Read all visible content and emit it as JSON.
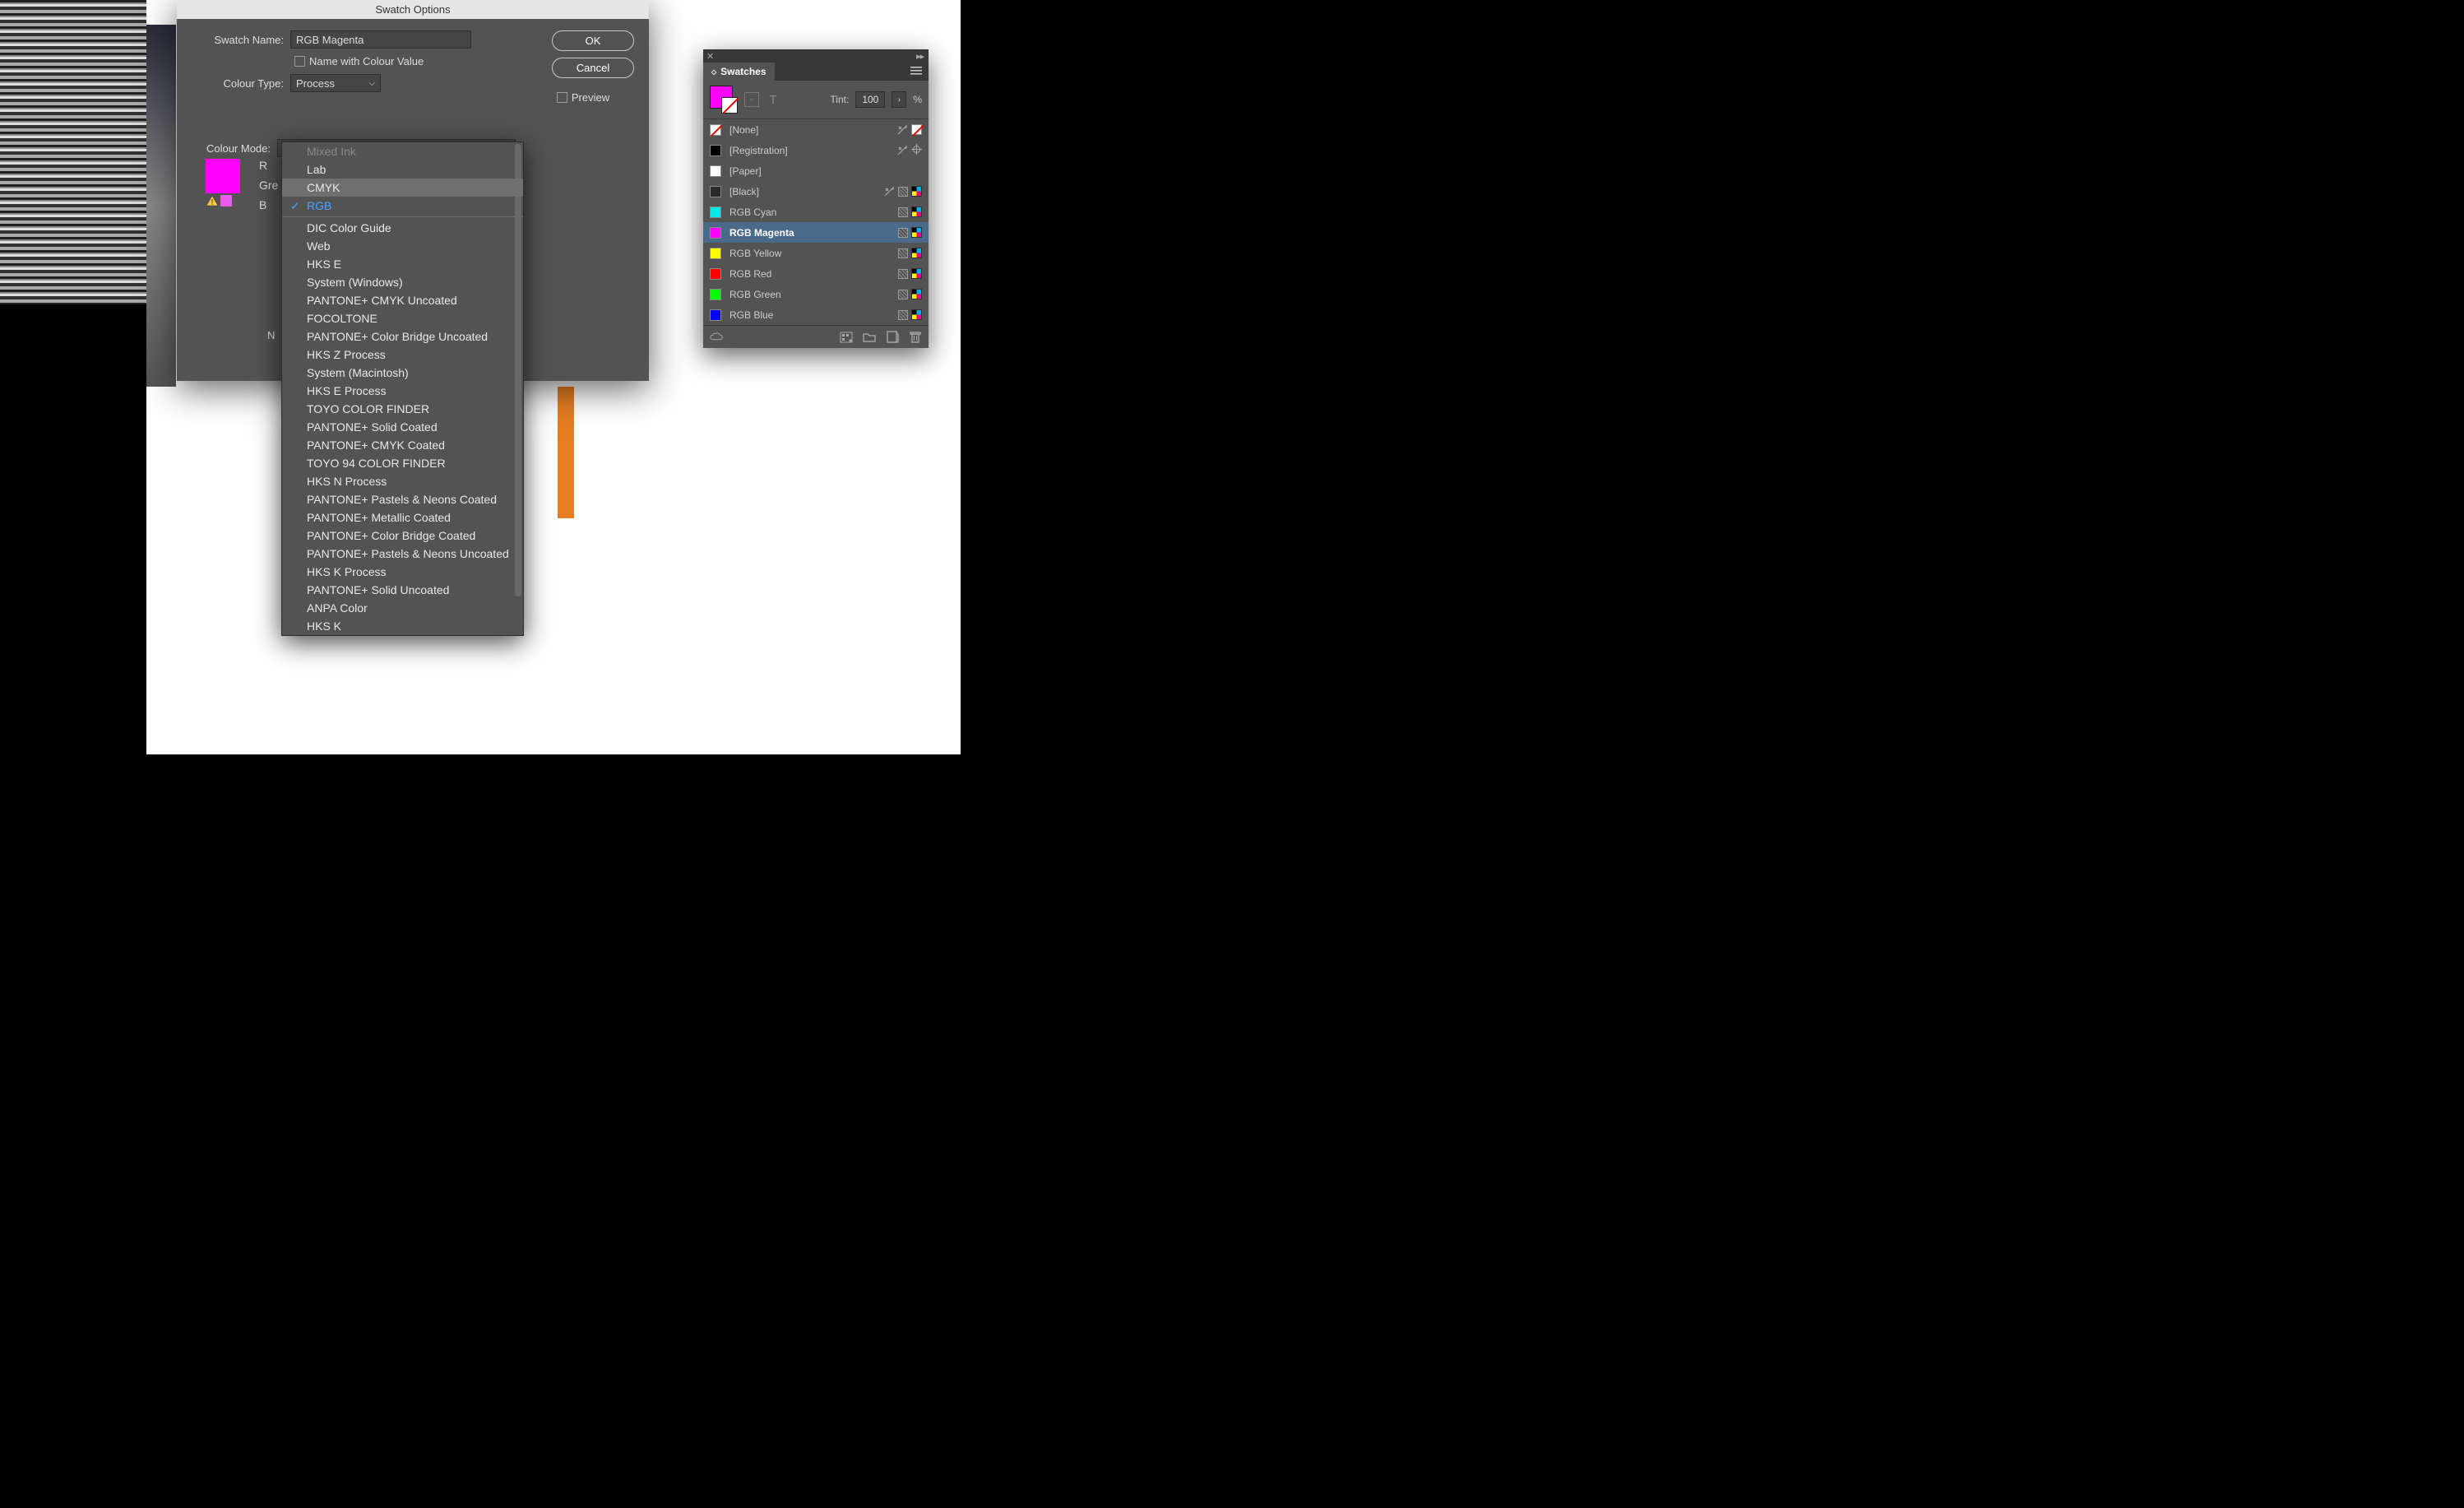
{
  "dialog": {
    "title": "Swatch Options",
    "swatch_name_label": "Swatch Name:",
    "swatch_name_value": "RGB Magenta",
    "name_with_colour_label": "Name with Colour Value",
    "colour_type_label": "Colour Type:",
    "colour_type_value": "Process",
    "colour_mode_label": "Colour Mode:",
    "colour_mode_value": "RGB",
    "ok_label": "OK",
    "cancel_label": "Cancel",
    "preview_label": "Preview",
    "slider_r": "R",
    "slider_g": "Gre",
    "slider_b": "B",
    "truncated_n": "N",
    "preview_colour": "#ff00ff"
  },
  "colour_modes": {
    "selected": "RGB",
    "hovered": "CMYK",
    "items": [
      {
        "label": "Mixed Ink",
        "disabled": true
      },
      {
        "label": "Lab"
      },
      {
        "label": "CMYK"
      },
      {
        "label": "RGB",
        "selected": true
      },
      {
        "sep": true
      },
      {
        "label": "DIC Color Guide"
      },
      {
        "label": "Web"
      },
      {
        "label": "HKS E"
      },
      {
        "label": "System (Windows)"
      },
      {
        "label": "PANTONE+ CMYK Uncoated"
      },
      {
        "label": "FOCOLTONE"
      },
      {
        "label": "PANTONE+ Color Bridge Uncoated"
      },
      {
        "label": "HKS Z Process"
      },
      {
        "label": "System (Macintosh)"
      },
      {
        "label": "HKS E Process"
      },
      {
        "label": "TOYO COLOR FINDER"
      },
      {
        "label": "PANTONE+ Solid Coated"
      },
      {
        "label": "PANTONE+ CMYK Coated"
      },
      {
        "label": "TOYO 94 COLOR FINDER"
      },
      {
        "label": "HKS N Process"
      },
      {
        "label": "PANTONE+ Pastels & Neons Coated"
      },
      {
        "label": "PANTONE+ Metallic Coated"
      },
      {
        "label": "PANTONE+ Color Bridge Coated"
      },
      {
        "label": "PANTONE+ Pastels & Neons Uncoated"
      },
      {
        "label": "HKS K Process"
      },
      {
        "label": "PANTONE+ Solid Uncoated"
      },
      {
        "label": "ANPA Color"
      },
      {
        "label": "HKS K"
      }
    ]
  },
  "panel": {
    "title": "Swatches",
    "tint_label": "Tint:",
    "tint_value": "100",
    "tint_unit": "%",
    "swatches": [
      {
        "name": "[None]",
        "key": "none",
        "colour": "#ffffff",
        "icons": [
          "pencilx",
          "none"
        ]
      },
      {
        "name": "[Registration]",
        "key": "reg",
        "colour": "#000000",
        "icons": [
          "pencilx",
          "reg"
        ]
      },
      {
        "name": "[Paper]",
        "key": "paper",
        "colour": "#ffffff",
        "icons": []
      },
      {
        "name": "[Black]",
        "key": "black",
        "colour": "#2a2a2a",
        "icons": [
          "pencilx",
          "hatch",
          "cmyk"
        ]
      },
      {
        "name": "RGB Cyan",
        "key": "cyan",
        "colour": "#00e8e8",
        "icons": [
          "hatch",
          "cmyk"
        ]
      },
      {
        "name": "RGB Magenta",
        "key": "magenta",
        "colour": "#ff00ff",
        "selected": true,
        "icons": [
          "hatch",
          "cmyk"
        ]
      },
      {
        "name": "RGB Yellow",
        "key": "yellow",
        "colour": "#ffff00",
        "icons": [
          "hatch",
          "cmyk"
        ]
      },
      {
        "name": "RGB Red",
        "key": "red",
        "colour": "#ff0000",
        "icons": [
          "hatch",
          "cmyk"
        ]
      },
      {
        "name": "RGB Green",
        "key": "green",
        "colour": "#00ff00",
        "icons": [
          "hatch",
          "cmyk"
        ]
      },
      {
        "name": "RGB Blue",
        "key": "blue",
        "colour": "#0000ff",
        "icons": [
          "hatch",
          "cmyk"
        ]
      }
    ]
  }
}
